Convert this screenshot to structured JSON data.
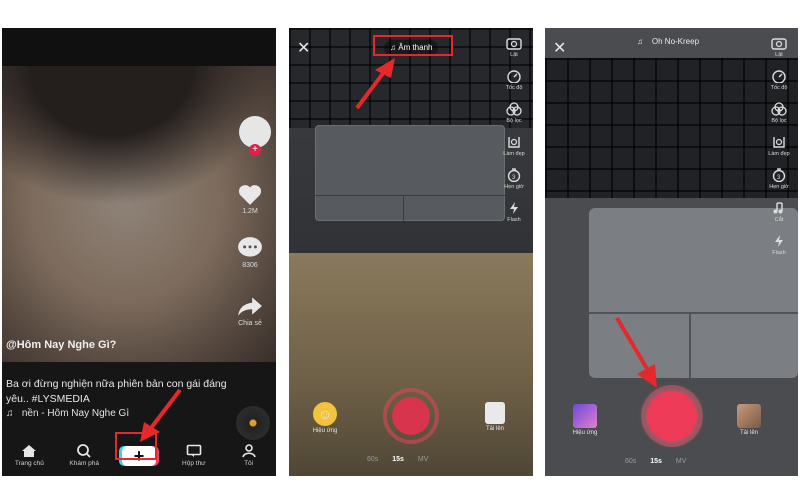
{
  "panel1": {
    "like_count": "1.2M",
    "comment_count": "8306",
    "share_label": "Chia sẻ",
    "caption_user": "@Hôm Nay Nghe Gì?",
    "caption_desc": "Ba ơi đừng nghiện nữa phiên bản con gái đáng yêu.. #LYSMEDIA",
    "caption_music": "nền - Hôm Nay Nghe Gì",
    "nav": {
      "home": "Trang chủ",
      "discover": "Khám phá",
      "create": "+",
      "inbox": "Hộp thư",
      "profile": "Tôi"
    }
  },
  "panel2": {
    "close": "✕",
    "sound_label": "Âm thanh",
    "tools": [
      "Lật",
      "Tốc độ",
      "Bộ lọc",
      "Làm đẹp",
      "Hẹn giờ",
      "Flash"
    ],
    "effects_label": "Hiệu ứng",
    "upload_label": "Tải lên",
    "modes": [
      "60s",
      "15s",
      "MV"
    ],
    "active_mode": "15s"
  },
  "panel3": {
    "close": "✕",
    "sound_title": "Oh No-Kreep",
    "tools": [
      "Lật",
      "Tốc độ",
      "Bộ lọc",
      "Làm đẹp",
      "Hẹn giờ",
      "Cắt",
      "Flash"
    ],
    "effects_label": "Hiệu ứng",
    "upload_label": "Tải lên",
    "modes": [
      "60s",
      "15s",
      "MV"
    ],
    "active_mode": "15s"
  },
  "colors": {
    "highlight_red": "#e5282b",
    "record_red": "#ee3b57",
    "tiktok_cyan": "#3bd4e2",
    "tiktok_pink": "#ef3f61"
  }
}
